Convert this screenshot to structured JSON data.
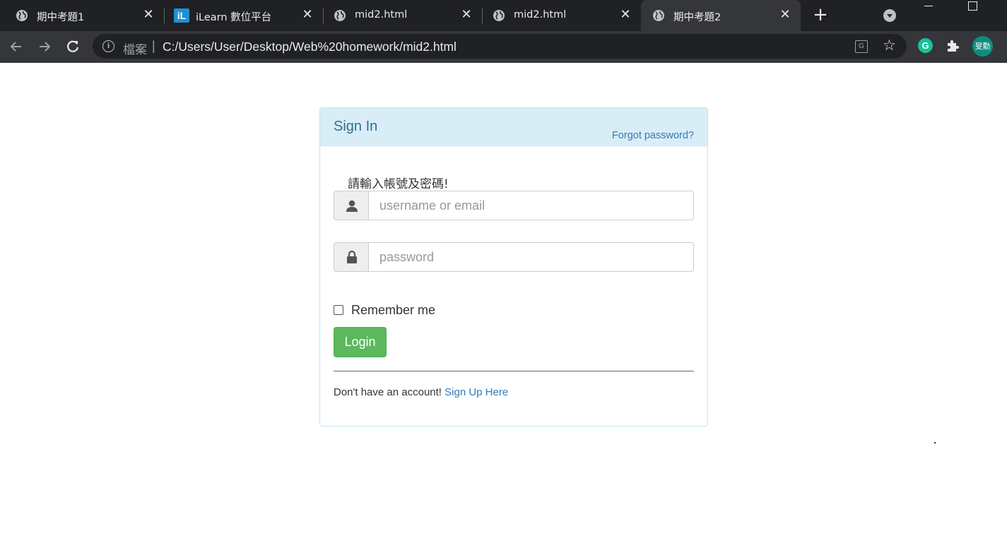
{
  "browser": {
    "tabs": [
      {
        "title": "期中考題1",
        "icon": "globe-icon"
      },
      {
        "title": "iLearn 數位平台",
        "icon": "ilearn-icon",
        "icon_text": "iL"
      },
      {
        "title": "mid2.html",
        "icon": "globe-icon"
      },
      {
        "title": "mid2.html",
        "icon": "globe-icon"
      },
      {
        "title": "期中考題2",
        "icon": "globe-icon",
        "active": true
      }
    ],
    "address": {
      "scheme_label": "檔案",
      "separator": "|",
      "url": "C:/Users/User/Desktop/Web%20homework/mid2.html"
    },
    "profile_avatar_text": "旻勳",
    "grammarly_text": "G",
    "translate_text": "G",
    "info_text": "i",
    "star_glyph": "☆",
    "close_glyph": "✕",
    "newtab_glyph": "+"
  },
  "login_panel": {
    "title": "Sign In",
    "forgot_password": "Forgot password?",
    "prompt": "請輸入帳號及密碼!",
    "username_placeholder": "username or email",
    "password_placeholder": "password",
    "remember_label": "Remember me",
    "login_button": "Login",
    "no_account_text": "Don't have an account!",
    "signup_link": "Sign Up Here"
  },
  "colors": {
    "chrome_dark": "#202124",
    "toolbar": "#35363a",
    "panel_heading_bg": "#d9edf7",
    "panel_title": "#31708f",
    "link": "#337ab7",
    "login_button": "#5cb85c"
  }
}
